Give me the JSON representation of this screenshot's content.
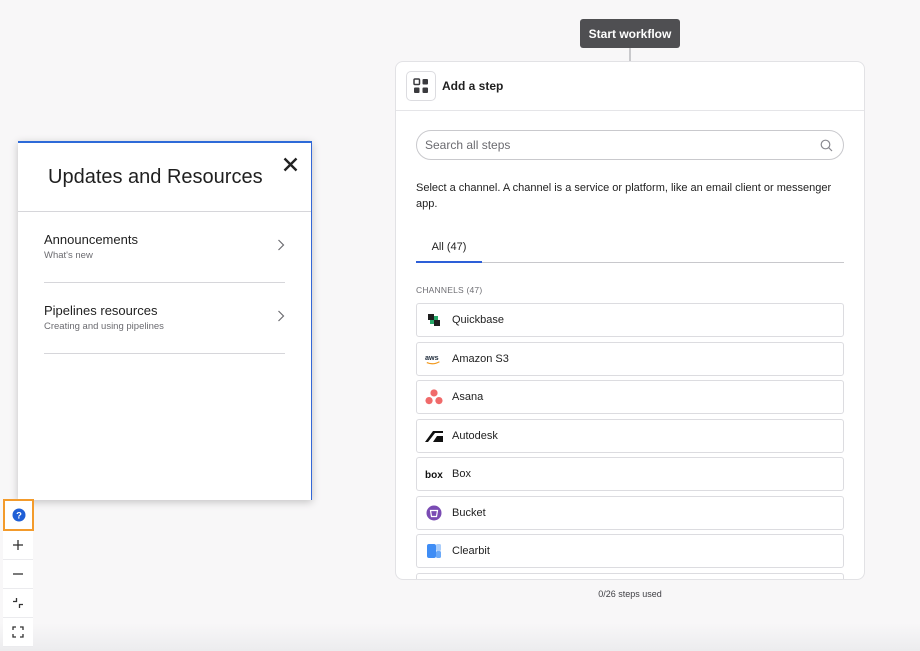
{
  "workflow": {
    "start_label": "Start workflow",
    "steps_used": "0/26 steps used"
  },
  "step_panel": {
    "title": "Add a step",
    "search_placeholder": "Search all steps",
    "description": "Select a channel. A channel is a service or platform, like an email client or messenger app.",
    "tab_all": "All (47)",
    "section_label": "CHANNELS (47)",
    "channels": [
      {
        "label": "Quickbase",
        "icon": "quickbase-icon"
      },
      {
        "label": "Amazon S3",
        "icon": "aws-icon"
      },
      {
        "label": "Asana",
        "icon": "asana-icon"
      },
      {
        "label": "Autodesk",
        "icon": "autodesk-icon"
      },
      {
        "label": "Box",
        "icon": "box-icon"
      },
      {
        "label": "Bucket",
        "icon": "bucket-icon"
      },
      {
        "label": "Clearbit",
        "icon": "clearbit-icon"
      }
    ]
  },
  "updates_panel": {
    "title": "Updates and Resources",
    "items": [
      {
        "title": "Announcements",
        "subtitle": "What's new"
      },
      {
        "title": "Pipelines resources",
        "subtitle": "Creating and using pipelines"
      }
    ]
  },
  "colors": {
    "accent_blue": "#2d6ad8",
    "help_highlight": "#f39b2c",
    "start_node_bg": "#4f4f52"
  }
}
